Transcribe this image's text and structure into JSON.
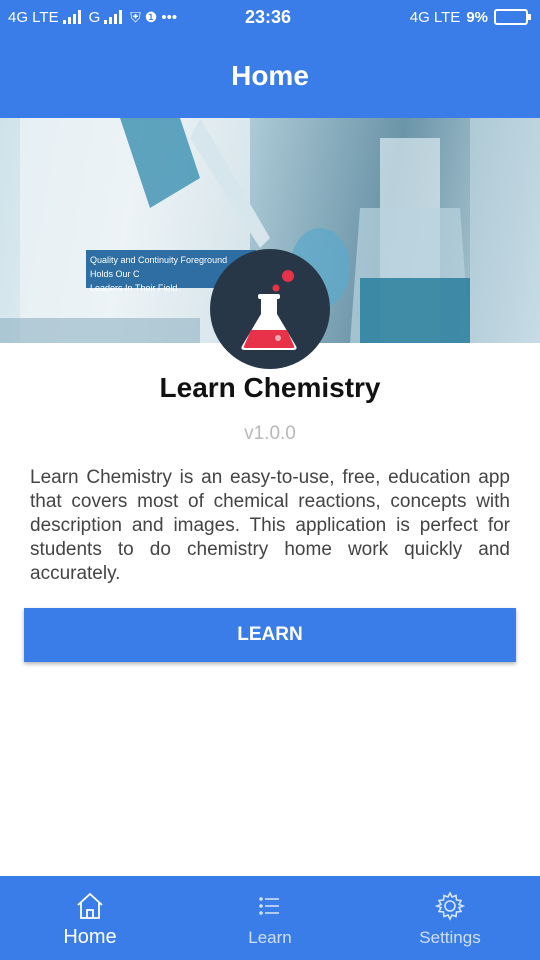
{
  "status_bar": {
    "network_left": "4G LTE",
    "network_g": "G",
    "dots": "•••",
    "time": "23:36",
    "network_right": "4G LTE",
    "battery": "9%"
  },
  "app_bar": {
    "title": "Home"
  },
  "hero": {
    "caption_line1": "Quality and Continuity Foreground Holds Our C",
    "caption_line2": "Leaders In Their Field."
  },
  "app_info": {
    "name": "Learn Chemistry",
    "version": "v1.0.0",
    "description": "Learn Chemistry is an easy-to-use, free, education app that covers most of chemical reactions, concepts with description and images. This application is perfect for students to do chemistry home work quickly and accurately."
  },
  "actions": {
    "learn_label": "LEARN"
  },
  "bottom_nav": {
    "items": [
      {
        "label": "Home",
        "icon": "home-icon",
        "active": true
      },
      {
        "label": "Learn",
        "icon": "list-icon",
        "active": false
      },
      {
        "label": "Settings",
        "icon": "gear-icon",
        "active": false
      }
    ]
  },
  "colors": {
    "primary": "#3a7de8",
    "logo_bg": "#273747",
    "flask_liquid": "#e8324a"
  }
}
